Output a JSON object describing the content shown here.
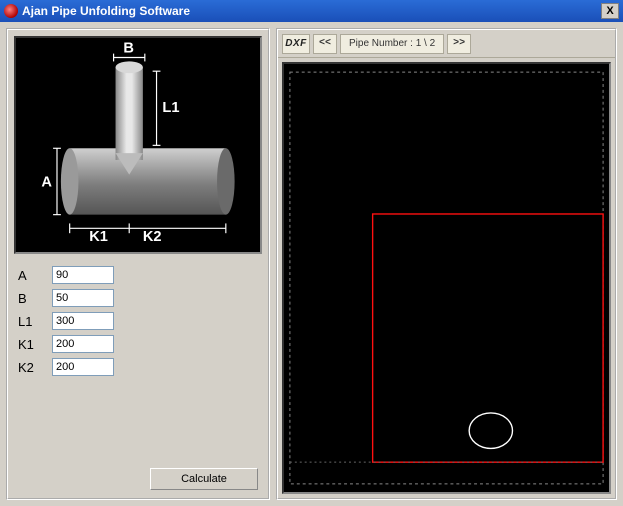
{
  "window": {
    "title": "Ajan Pipe Unfolding Software",
    "close_glyph": "X"
  },
  "diagram": {
    "labels": {
      "A": "A",
      "B": "B",
      "L1": "L1",
      "K1": "K1",
      "K2": "K2"
    }
  },
  "form": {
    "A": {
      "label": "A",
      "value": "90"
    },
    "B": {
      "label": "B",
      "value": "50"
    },
    "L1": {
      "label": "L1",
      "value": "300"
    },
    "K1": {
      "label": "K1",
      "value": "200"
    },
    "K2": {
      "label": "K2",
      "value": "200"
    }
  },
  "buttons": {
    "calculate": "Calculate"
  },
  "toolbar": {
    "dxf": "DXF",
    "prev": "<<",
    "pipe_label": "Pipe Number : 1 \\ 2",
    "next": ">>"
  }
}
